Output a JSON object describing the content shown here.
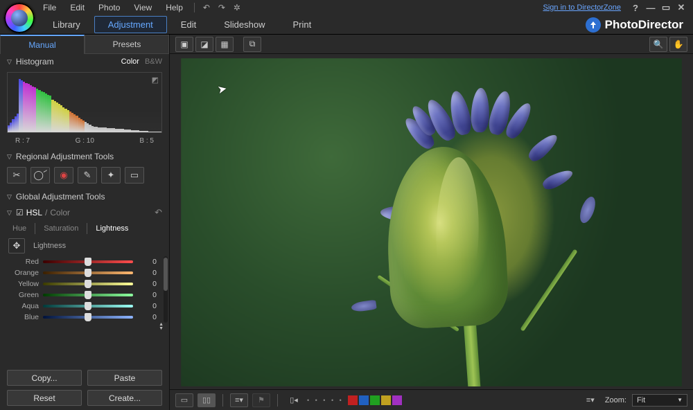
{
  "menu": {
    "file": "File",
    "edit": "Edit",
    "photo": "Photo",
    "view": "View",
    "help": "Help"
  },
  "signin": "Sign in to DirectorZone",
  "brand": "PhotoDirector",
  "modules": {
    "library": "Library",
    "adjustment": "Adjustment",
    "edit": "Edit",
    "slideshow": "Slideshow",
    "print": "Print",
    "active": "adjustment"
  },
  "subtabs": {
    "manual": "Manual",
    "presets": "Presets",
    "active": "manual"
  },
  "sections": {
    "histogram": "Histogram",
    "regional": "Regional Adjustment Tools",
    "global": "Global Adjustment Tools"
  },
  "histogram": {
    "color_mode": "Color",
    "bw_mode": "B&W",
    "readout": {
      "r": "R : 7",
      "g": "G : 10",
      "b": "B : 5"
    }
  },
  "hsl": {
    "title_hsl": "HSL",
    "title_sep": "/",
    "title_color": "Color",
    "tabs": {
      "hue": "Hue",
      "saturation": "Saturation",
      "lightness": "Lightness",
      "active": "lightness"
    },
    "group_label": "Lightness",
    "channels": [
      {
        "name": "Red",
        "value": 0,
        "grad": [
          "#3a0000",
          "#ff4d4d"
        ]
      },
      {
        "name": "Orange",
        "value": 0,
        "grad": [
          "#3a1f00",
          "#ffb870"
        ]
      },
      {
        "name": "Yellow",
        "value": 0,
        "grad": [
          "#3a3a00",
          "#ffff99"
        ]
      },
      {
        "name": "Green",
        "value": 0,
        "grad": [
          "#003a00",
          "#8dffa0"
        ]
      },
      {
        "name": "Aqua",
        "value": 0,
        "grad": [
          "#003a3a",
          "#9dfff5"
        ]
      },
      {
        "name": "Blue",
        "value": 0,
        "grad": [
          "#00123a",
          "#8db4ff"
        ]
      }
    ]
  },
  "buttons": {
    "copy": "Copy...",
    "paste": "Paste",
    "reset": "Reset",
    "create": "Create..."
  },
  "bottom": {
    "zoom_label": "Zoom:",
    "zoom_value": "Fit",
    "color_chips": [
      "#c02020",
      "#2060c0",
      "#20a020",
      "#c0a020",
      "#a030c0"
    ]
  }
}
